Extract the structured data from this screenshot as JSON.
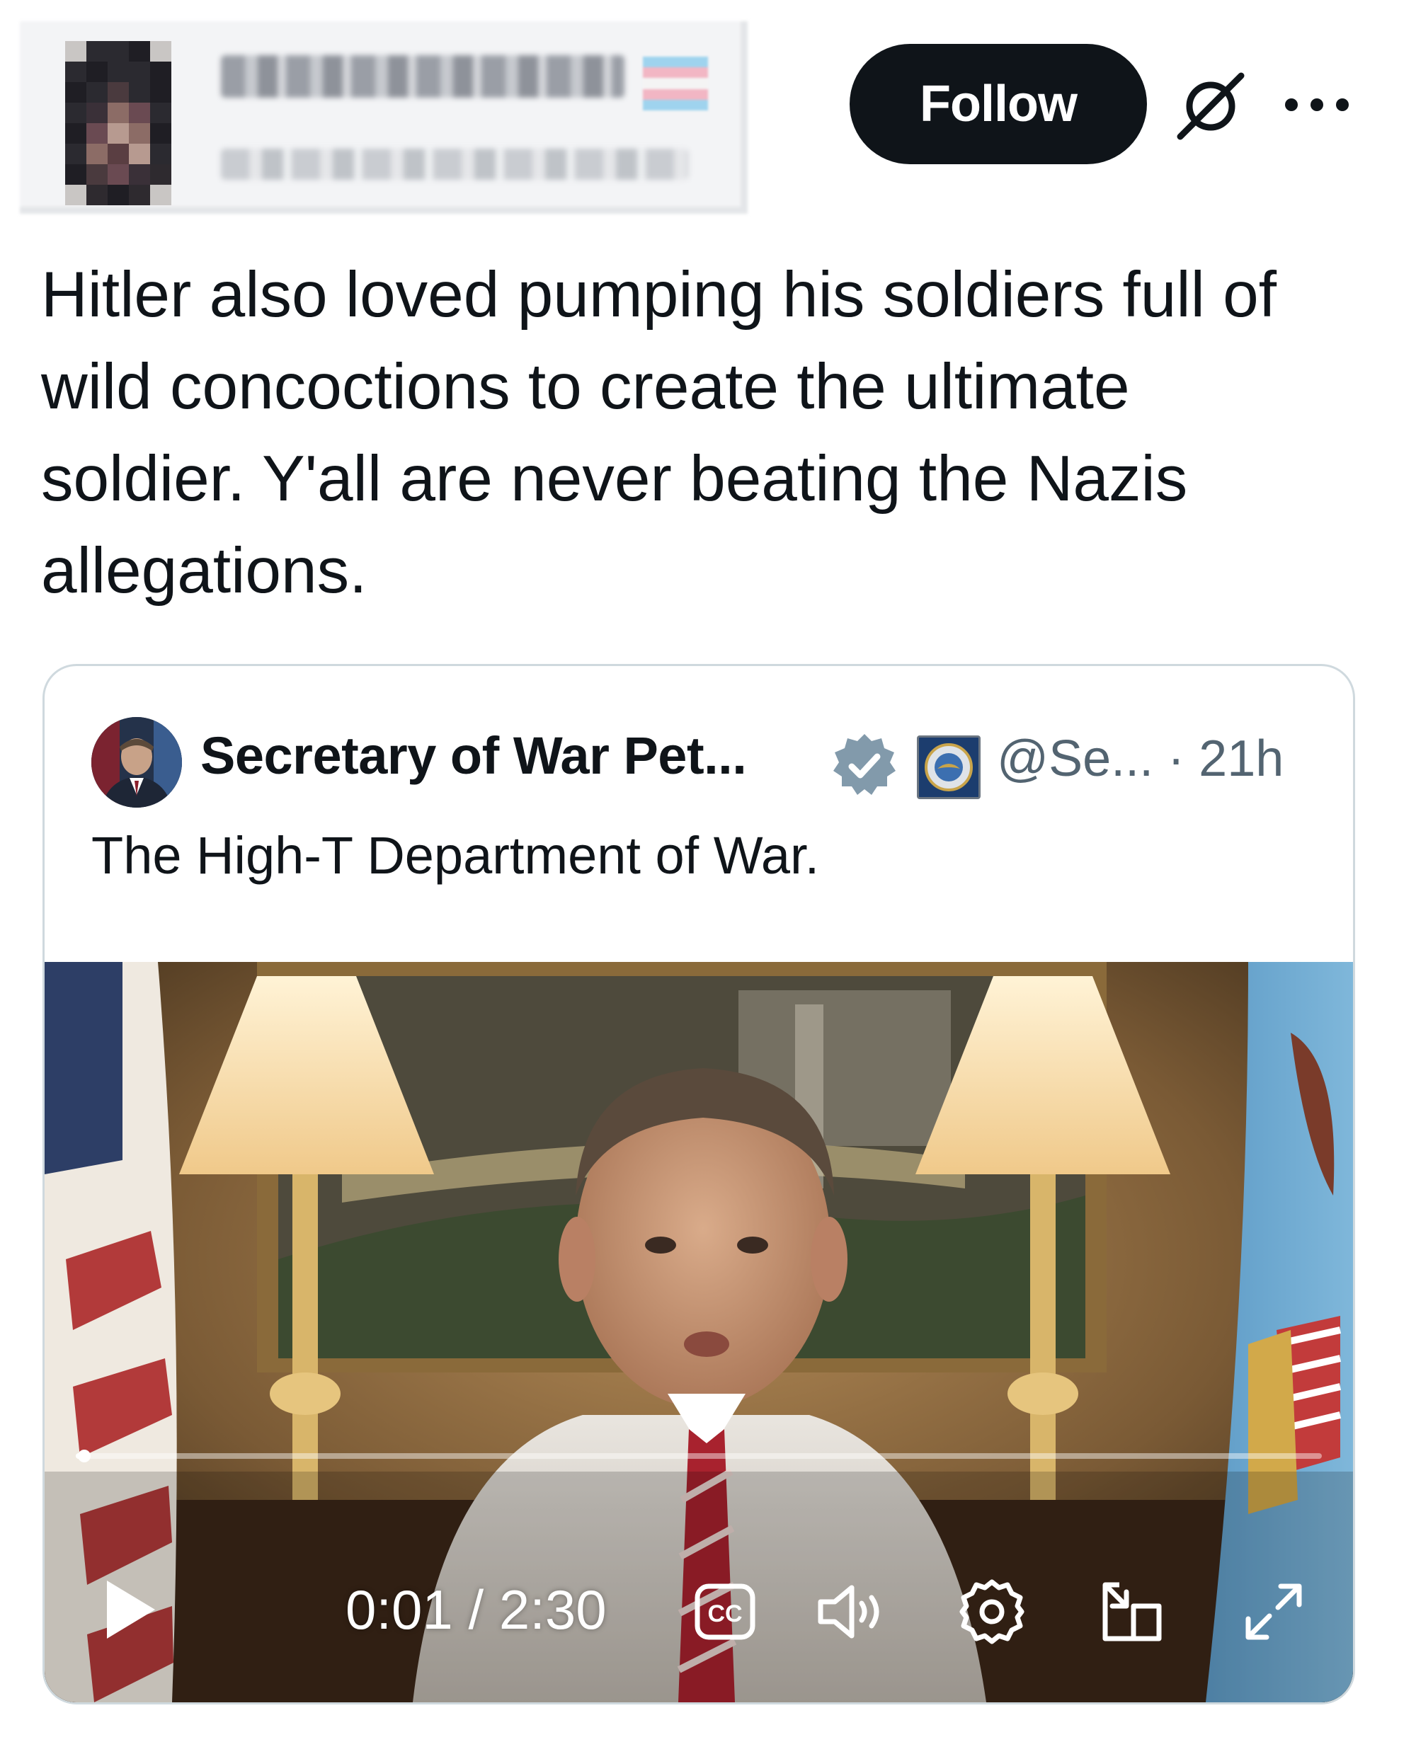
{
  "post": {
    "follow_label": "Follow",
    "text": "Hitler also loved pumping his soldiers full of\nwild concoctions to create the ultimate\nsoldier. Y'all are never beating the Nazis\nallegations.",
    "icons": [
      "grok-icon",
      "more-icon"
    ]
  },
  "quote": {
    "author_name": "Secretary of War Pet...",
    "handle_time": "@Se... · 21h",
    "text": "The High-T Department of War.",
    "icons": [
      "verified-badge-icon",
      "dod-seal-icon"
    ]
  },
  "video": {
    "time": "0:01 / 2:30",
    "progress_fraction": 0.007,
    "icons": [
      "play-icon",
      "captions-icon",
      "volume-icon",
      "settings-icon",
      "pop-out-icon",
      "fullscreen-icon"
    ]
  },
  "colors": {
    "text": "#0f1419",
    "secondary": "#536471",
    "border": "#cfd9de",
    "follow_bg": "#0f1419",
    "verified": "#829aab"
  }
}
